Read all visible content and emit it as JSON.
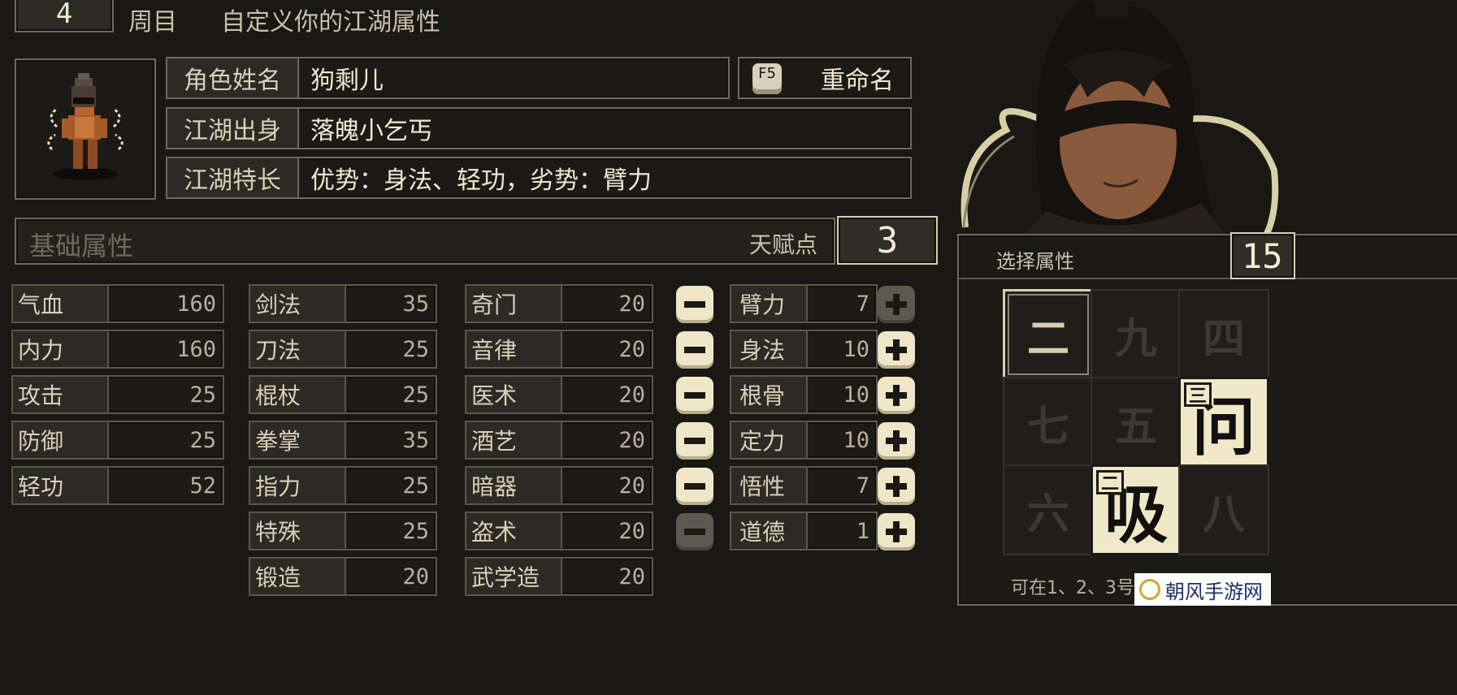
{
  "header": {
    "cycle": "4",
    "cycle_label": "周目",
    "title": "自定义你的江湖属性"
  },
  "profile": {
    "name_label": "角色姓名",
    "name_value": "狗剩儿",
    "rename_key": "F5",
    "rename_label": "重命名",
    "origin_label": "江湖出身",
    "origin_value": "落魄小乞丐",
    "trait_label": "江湖特长",
    "trait_value": "优势：身法、轻功，劣势：臂力"
  },
  "base": {
    "title": "基础属性",
    "talent_label": "天赋点",
    "talent_value": "3"
  },
  "stats_col1": [
    {
      "label": "气血",
      "value": "160"
    },
    {
      "label": "内力",
      "value": "160"
    },
    {
      "label": "攻击",
      "value": "25"
    },
    {
      "label": "防御",
      "value": "25"
    },
    {
      "label": "轻功",
      "value": "52"
    }
  ],
  "stats_col2": [
    {
      "label": "剑法",
      "value": "35"
    },
    {
      "label": "刀法",
      "value": "25"
    },
    {
      "label": "棍杖",
      "value": "25"
    },
    {
      "label": "拳掌",
      "value": "35"
    },
    {
      "label": "指力",
      "value": "25"
    },
    {
      "label": "特殊",
      "value": "25"
    },
    {
      "label": "锻造",
      "value": "20"
    }
  ],
  "stats_col3": [
    {
      "label": "奇门",
      "value": "20"
    },
    {
      "label": "音律",
      "value": "20"
    },
    {
      "label": "医术",
      "value": "20"
    },
    {
      "label": "酒艺",
      "value": "20"
    },
    {
      "label": "暗器",
      "value": "20"
    },
    {
      "label": "盗术",
      "value": "20"
    },
    {
      "label": "武学造",
      "value": "20"
    }
  ],
  "talents": [
    {
      "label": "臂力",
      "value": "7"
    },
    {
      "label": "身法",
      "value": "10"
    },
    {
      "label": "根骨",
      "value": "10"
    },
    {
      "label": "定力",
      "value": "10"
    },
    {
      "label": "悟性",
      "value": "7"
    },
    {
      "label": "道德",
      "value": "1"
    }
  ],
  "select_panel": {
    "title": "选择属性",
    "count": "15",
    "tiles": [
      "二",
      "九",
      "四",
      "七",
      "五",
      "问",
      "六",
      "吸",
      "八"
    ],
    "tile_tag_wen": "三",
    "tile_tag_xi": "二",
    "hint": "可在1、2、3号"
  },
  "watermark": "朝风手游网",
  "colors": {
    "accent": "#efe6c8",
    "bg": "#191814",
    "border": "#6e6a5c"
  }
}
